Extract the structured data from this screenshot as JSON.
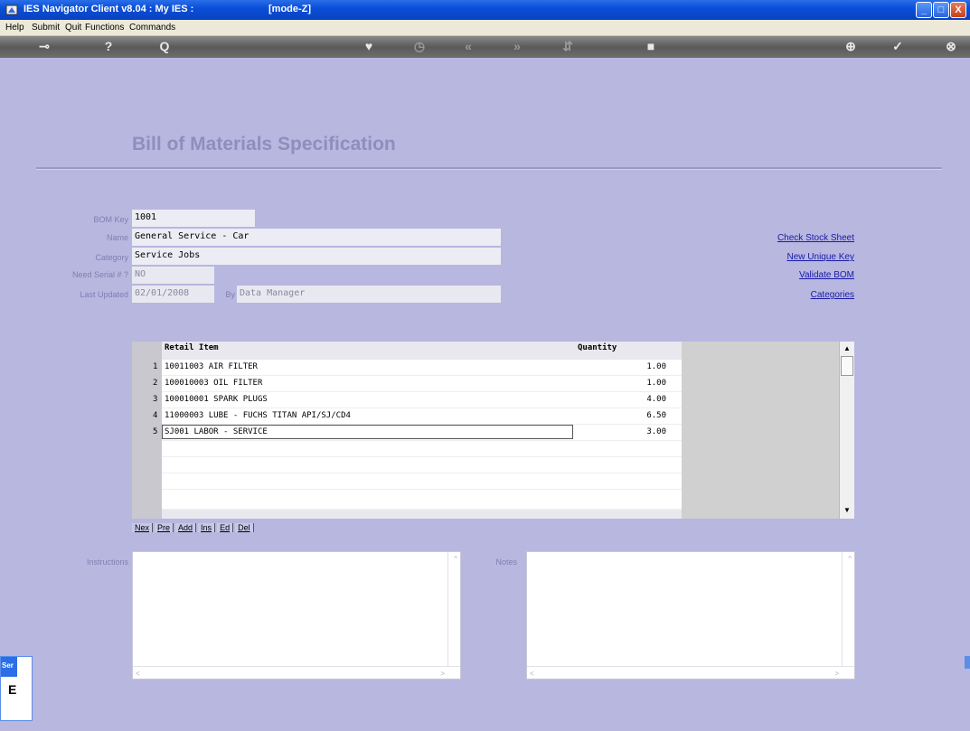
{
  "window": {
    "title": "IES Navigator Client v8.04 : My IES :",
    "mode": "[mode-Z]",
    "controls": {
      "minimize": "_",
      "maximize": "□",
      "close": "X"
    }
  },
  "menu": [
    "Help",
    "Submit",
    "Quit",
    "Functions",
    "Commands"
  ],
  "toolbar": {
    "icons": [
      "key-icon",
      "help-icon",
      "search-icon",
      "heart-icon",
      "clock-icon",
      "rewind-icon",
      "forward-icon",
      "split-icon",
      "stop-icon",
      "record-icon",
      "check-icon",
      "close-icon"
    ],
    "glyphs": {
      "key": "⊸",
      "help": "?",
      "search": "Q",
      "heart": "♥",
      "clock": "◷",
      "rewind": "«",
      "forward": "»",
      "split": "⇵",
      "stop": "■",
      "record": "⊕",
      "check": "✓",
      "close": "⊗"
    }
  },
  "page": {
    "heading": "Bill of Materials Specification"
  },
  "form": {
    "bom_key": {
      "label": "BOM Key",
      "value": "1001"
    },
    "name": {
      "label": "Name",
      "value": "General Service - Car"
    },
    "category": {
      "label": "Category",
      "value": "Service Jobs"
    },
    "need_serial": {
      "label": "Need Serial # ?",
      "value": "NO"
    },
    "last_updated": {
      "label": "Last Updated",
      "value": "02/01/2008"
    },
    "by": {
      "label": "By",
      "value": "Data Manager"
    }
  },
  "links": [
    "Check Stock Sheet",
    "New Unique Key",
    "Validate BOM",
    "Categories"
  ],
  "grid": {
    "columns": [
      "Retail Item",
      "Quantity"
    ],
    "rows": [
      {
        "num": "1",
        "item": "10011003 AIR FILTER",
        "qty": "1.00"
      },
      {
        "num": "2",
        "item": "100010003 OIL FILTER",
        "qty": "1.00"
      },
      {
        "num": "3",
        "item": "100010001 SPARK PLUGS",
        "qty": "4.00"
      },
      {
        "num": "4",
        "item": "11000003 LUBE - FUCHS TITAN API/SJ/CD4",
        "qty": "6.50"
      },
      {
        "num": "5",
        "item": "SJ001 LABOR - SERVICE",
        "qty": "3.00"
      }
    ],
    "nav_buttons": [
      "Nex",
      "Pre",
      "Add",
      "Ins",
      "Ed",
      "Del"
    ]
  },
  "memos": {
    "instructions_label": "Instructions",
    "notes_label": "Notes"
  },
  "taskbar": {
    "tab_label": "Ser",
    "glyph": "E"
  }
}
